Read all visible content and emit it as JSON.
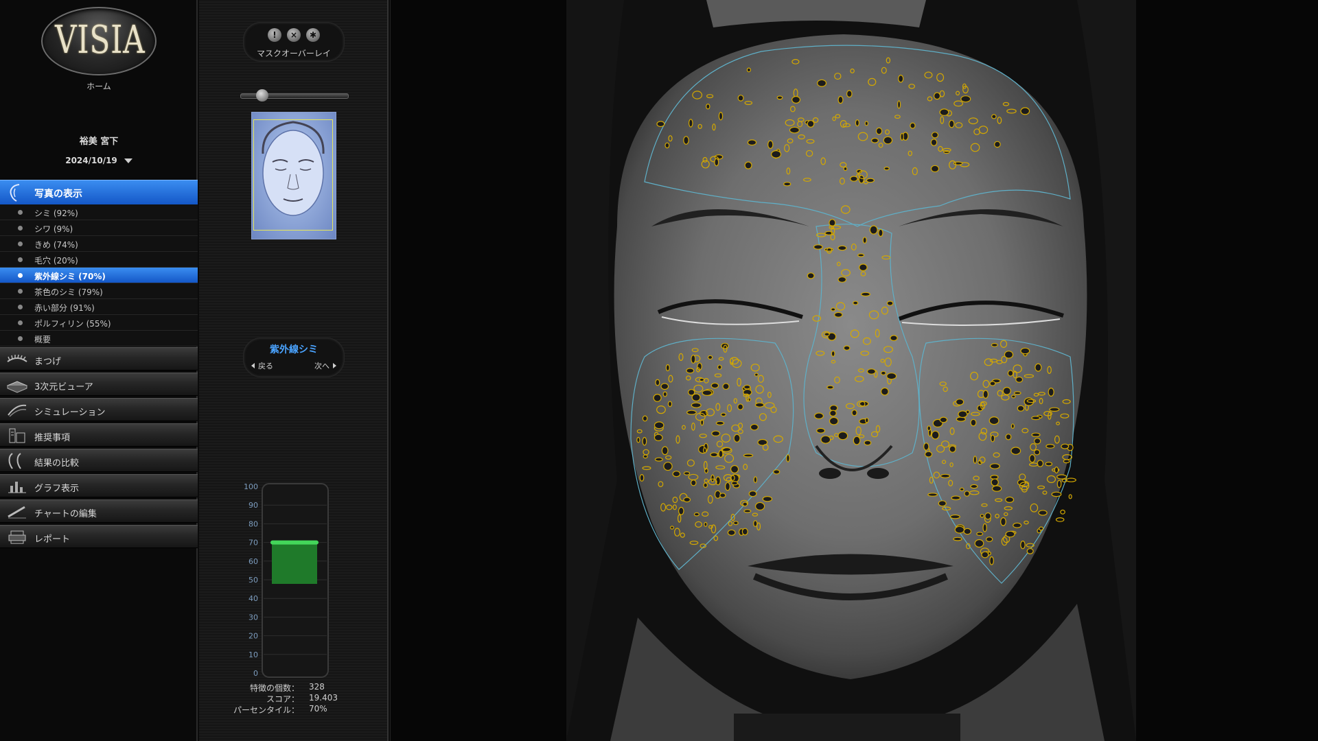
{
  "app": {
    "logo": "VISIA",
    "home_label": "ホーム"
  },
  "patient": {
    "name": "裕美 宮下",
    "date": "2024/10/19"
  },
  "nav_top": {
    "label": "写真の表示",
    "icon": "face-profile-icon"
  },
  "sub_items": [
    {
      "label": "シミ (92%)",
      "active": false
    },
    {
      "label": "シワ (9%)",
      "active": false
    },
    {
      "label": "きめ (74%)",
      "active": false
    },
    {
      "label": "毛穴 (20%)",
      "active": false
    },
    {
      "label": "紫外線シミ (70%)",
      "active": true
    },
    {
      "label": "茶色のシミ (79%)",
      "active": false
    },
    {
      "label": "赤い部分 (91%)",
      "active": false
    },
    {
      "label": "ポルフィリン (55%)",
      "active": false
    },
    {
      "label": "概要",
      "active": false
    }
  ],
  "nav_buttons": [
    {
      "label": "まつげ",
      "icon": "eyelash-icon"
    },
    {
      "label": "3次元ビューア",
      "icon": "3d-viewer-icon"
    },
    {
      "label": "シミュレーション",
      "icon": "simulation-icon"
    },
    {
      "label": "推奨事項",
      "icon": "recommendation-icon"
    },
    {
      "label": "結果の比較",
      "icon": "compare-icon"
    },
    {
      "label": "グラフ表示",
      "icon": "graph-icon"
    },
    {
      "label": "チャートの編集",
      "icon": "chart-edit-icon"
    },
    {
      "label": "レポート",
      "icon": "report-icon"
    }
  ],
  "mask": {
    "label": "マスクオーバーレイ",
    "buttons": [
      "info-icon",
      "close-icon",
      "asterisk-icon"
    ]
  },
  "analysis": {
    "type": "紫外線シミ",
    "prev": "戻る",
    "next": "次へ"
  },
  "gauge": {
    "ticks": [
      "100",
      "90",
      "80",
      "70",
      "60",
      "50",
      "40",
      "30",
      "20",
      "10",
      "0"
    ],
    "value": 70,
    "bar_color": "#1f7a2a"
  },
  "stats": {
    "count_label": "特徴の個数：",
    "count": "328",
    "score_label": "スコア：",
    "score": "19.403",
    "percentile_label": "パーセンタイル：",
    "percentile": "70%"
  },
  "colors": {
    "accent": "#2a7ae6",
    "highlight_blue": "#4aa3ff",
    "spot_outline": "#d4a800",
    "zone_outline": "#5fb0c8"
  }
}
